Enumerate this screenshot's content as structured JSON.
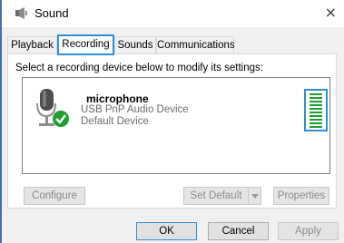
{
  "window": {
    "title": "Sound",
    "close_glyph": "×"
  },
  "tabs": [
    {
      "label": "Playback"
    },
    {
      "label": "Recording"
    },
    {
      "label": "Sounds"
    },
    {
      "label": "Communications"
    }
  ],
  "recording": {
    "instruction": "Select a recording device below to modify its settings:",
    "devices": [
      {
        "name": "microphone",
        "description": "USB PnP Audio Device",
        "status": "Default Device",
        "icon": "microphone-icon",
        "badge": "green-check-badge-icon",
        "level_percent": 100
      }
    ]
  },
  "buttons": {
    "configure": "Configure",
    "set_default": "Set Default",
    "properties": "Properties",
    "ok": "OK",
    "cancel": "Cancel",
    "apply": "Apply"
  },
  "colors": {
    "highlight": "#2f8fd6",
    "level": "#1e9e2e",
    "check": "#1e9e2e"
  }
}
